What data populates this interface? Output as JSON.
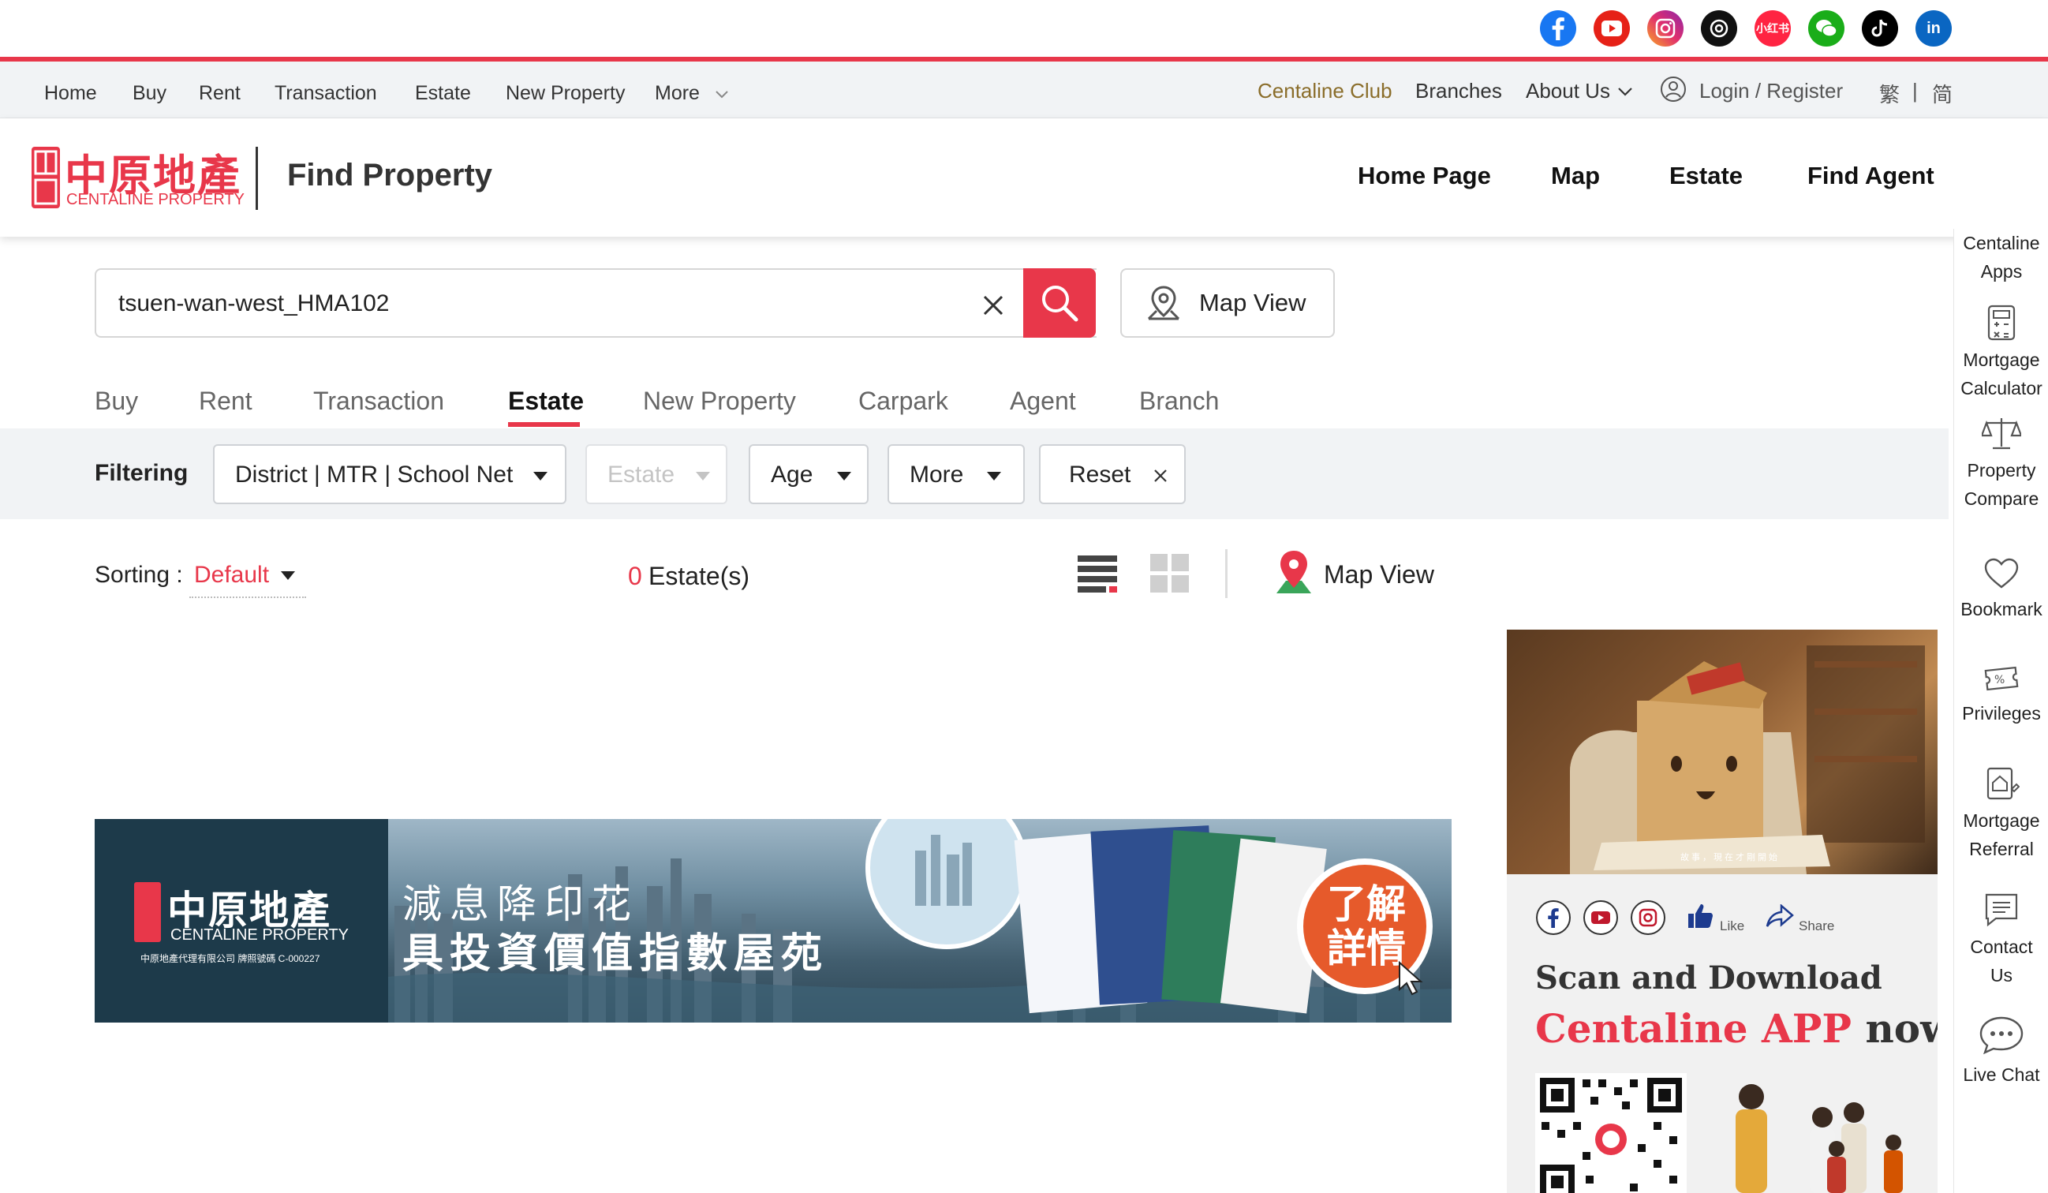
{
  "social": {
    "icons": [
      "facebook-icon",
      "youtube-icon",
      "instagram-icon",
      "threads-icon",
      "xiaohongshu-icon",
      "wechat-icon",
      "tiktok-icon",
      "linkedin-icon"
    ],
    "xhs_label": "小红书",
    "in_label": "in"
  },
  "topnav": {
    "left": [
      "Home",
      "Buy",
      "Rent",
      "Transaction",
      "Estate",
      "New Property",
      "More"
    ],
    "club": "Centaline Club",
    "branches": "Branches",
    "about": "About Us",
    "login": "Login / Register",
    "trad": "繁",
    "sep": "|",
    "simp": "简"
  },
  "header": {
    "logo_cn": "中原地產",
    "logo_en": "CENTALINE PROPERTY",
    "title": "Find Property",
    "nav": [
      "Home Page",
      "Map",
      "Estate",
      "Find Agent"
    ]
  },
  "search": {
    "value": "tsuen-wan-west_HMA102",
    "map_view": "Map View"
  },
  "tabs": [
    "Buy",
    "Rent",
    "Transaction",
    "Estate",
    "New Property",
    "Carpark",
    "Agent",
    "Branch"
  ],
  "active_tab": "Estate",
  "filter": {
    "label": "Filtering",
    "district": "District | MTR | School Net",
    "estate": "Estate",
    "age": "Age",
    "more": "More",
    "reset": "Reset"
  },
  "results": {
    "sorting_label": "Sorting :",
    "sorting_value": "Default",
    "count": "0",
    "count_unit": "Estate(s)",
    "map_view": "Map View"
  },
  "banner": {
    "logo_cn": "中原地產",
    "logo_en": "CENTALINE PROPERTY",
    "license": "中原地產代理有限公司  牌照號碼 C-000227",
    "line1": "減息降印花",
    "line2": "具投資價值指數屋苑",
    "cta": "了解\n詳情",
    "cta1": "了解",
    "cta2": "詳情"
  },
  "ad": {
    "caption": "故事，現在才剛開始",
    "like": "Like",
    "share": "Share",
    "line1": "Scan and Download",
    "line2_red": "Centaline APP",
    "line2_rest": "now!"
  },
  "sidebar": {
    "items": [
      {
        "label1": "Centaline",
        "label2": "Apps"
      },
      {
        "label1": "Mortgage",
        "label2": "Calculator"
      },
      {
        "label1": "Property",
        "label2": "Compare"
      },
      {
        "label1": "Bookmark",
        "label2": ""
      },
      {
        "label1": "Privileges",
        "label2": ""
      },
      {
        "label1": "Mortgage",
        "label2": "Referral"
      },
      {
        "label1": "Contact",
        "label2": "Us"
      },
      {
        "label1": "Live Chat",
        "label2": ""
      }
    ]
  },
  "colors": {
    "brand_red": "#e8374a",
    "club_gold": "#8a6d2a",
    "filter_bg": "#f1f3f5"
  }
}
